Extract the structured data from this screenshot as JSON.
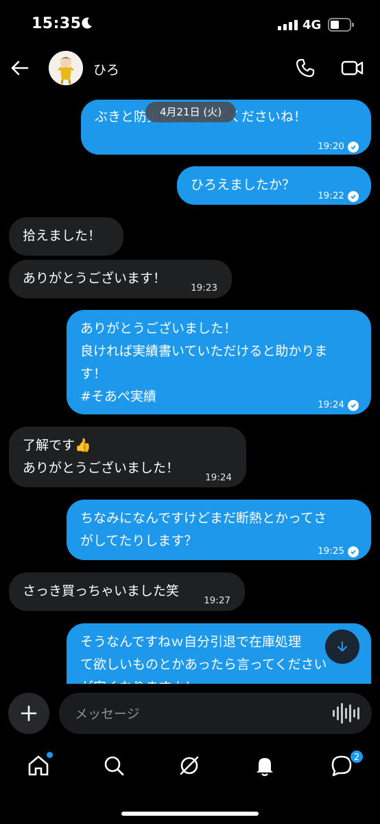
{
  "status": {
    "time": "15:35",
    "network": "4G"
  },
  "header": {
    "contact_name": "ひろ"
  },
  "date_pill": "4月21日 (火)",
  "messages": [
    {
      "dir": "out",
      "lines": [
        "ぶきと防災の方 てきてくださいね！"
      ],
      "time": "19:20",
      "read": true
    },
    {
      "dir": "out",
      "lines": [
        "ひろえましたか？"
      ],
      "time": "19:22",
      "read": true
    },
    {
      "dir": "in",
      "lines": [
        "拾えました！"
      ],
      "time": ""
    },
    {
      "dir": "in",
      "lines": [
        "ありがとうございます！"
      ],
      "time": "19:23"
    },
    {
      "dir": "out",
      "lines": [
        "ありがとうございました！",
        "良ければ実績書いていただけると助かりま",
        "す！",
        "#そあぺ実績"
      ],
      "time": "19:24",
      "read": true
    },
    {
      "dir": "in",
      "lines": [
        "了解です👍",
        "ありがとうございました！"
      ],
      "time": "19:24"
    },
    {
      "dir": "out",
      "lines": [
        "ちなみになんですけどまだ断熱とかってさ",
        "がしてたりします？"
      ],
      "time": "19:25",
      "read": true
    },
    {
      "dir": "in",
      "lines": [
        "さっき買っちゃいました笑"
      ],
      "time": "19:27"
    },
    {
      "dir": "out",
      "lines": [
        "そうなんですねｗ自分引退で在庫処理",
        "て欲しいものとかあったら言ってください",
        "が安くなりますよ！"
      ],
      "time": "",
      "read": false
    }
  ],
  "composer": {
    "placeholder": "メッセージ"
  },
  "nav": {
    "messages_badge": "2"
  },
  "colors": {
    "outgoing": "#1d98ea",
    "incoming": "#1f2022",
    "background": "#000000"
  },
  "icons": [
    "back-arrow-icon",
    "phone-icon",
    "video-camera-icon",
    "plus-icon",
    "voice-wave-icon",
    "home-icon",
    "search-icon",
    "spaces-icon",
    "bell-icon",
    "messages-icon",
    "arrow-down-icon"
  ]
}
